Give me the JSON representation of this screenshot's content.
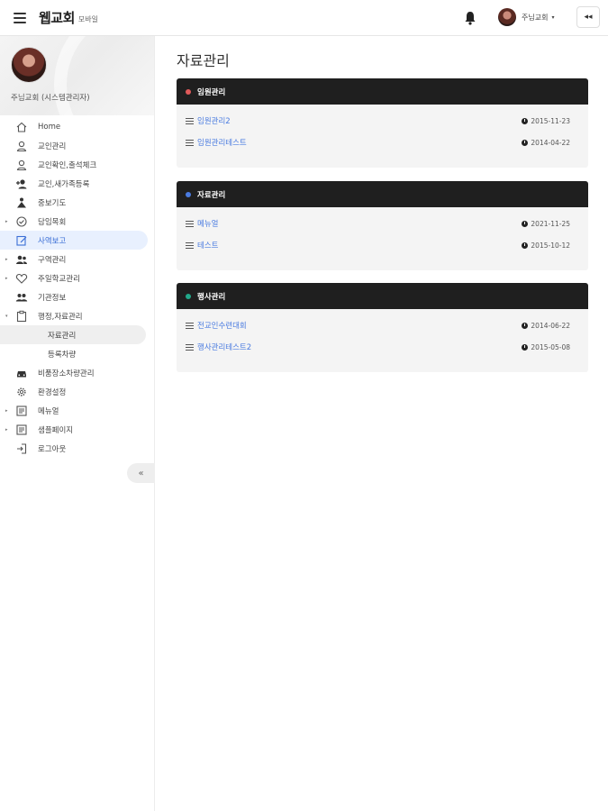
{
  "header": {
    "app_title": "웹교회",
    "app_sub": "모바일",
    "user_name": "주님교회",
    "collapse_label": "◂◂"
  },
  "sidebar": {
    "profile_name": "주님교회 (시스템관리자)",
    "items": [
      {
        "label": "Home",
        "icon": "home-icon",
        "arrow": ""
      },
      {
        "label": "교인관리",
        "icon": "person-outline-icon",
        "arrow": ""
      },
      {
        "label": "교인확인,출석체크",
        "icon": "person-check-icon",
        "arrow": ""
      },
      {
        "label": "교인,새가족등록",
        "icon": "person-add-icon",
        "arrow": ""
      },
      {
        "label": "중보기도",
        "icon": "pray-icon",
        "arrow": ""
      },
      {
        "label": "담임목회",
        "icon": "check-circle-icon",
        "arrow": "▸"
      },
      {
        "label": "사역보고",
        "icon": "edit-note-icon",
        "arrow": ""
      },
      {
        "label": "구역관리",
        "icon": "group-icon",
        "arrow": "▸"
      },
      {
        "label": "주일학교관리",
        "icon": "heart-icon",
        "arrow": "▸"
      },
      {
        "label": "기관정보",
        "icon": "people-icon",
        "arrow": ""
      },
      {
        "label": "행정,자료관리",
        "icon": "clipboard-icon",
        "arrow": "▾"
      }
    ],
    "sub_items": [
      {
        "label": "자료관리"
      },
      {
        "label": "등록차량"
      }
    ],
    "items_after": [
      {
        "label": "비품장소차량관리",
        "icon": "car-icon",
        "arrow": ""
      },
      {
        "label": "환경설정",
        "icon": "gear-icon",
        "arrow": ""
      },
      {
        "label": "메뉴얼",
        "icon": "book-icon",
        "arrow": "▸"
      },
      {
        "label": "샘플페이지",
        "icon": "page-icon",
        "arrow": "▸"
      },
      {
        "label": "로그아웃",
        "icon": "logout-icon",
        "arrow": ""
      }
    ],
    "collapse_label": "«"
  },
  "main": {
    "page_title": "자료관리",
    "panels": [
      {
        "title": "임원관리",
        "dot_color": "#e05a5a",
        "rows": [
          {
            "label": "임원관리2",
            "date": "2015-11-23"
          },
          {
            "label": "임원관리테스트",
            "date": "2014-04-22"
          }
        ]
      },
      {
        "title": "자료관리",
        "dot_color": "#4a7be0",
        "rows": [
          {
            "label": "메뉴얼",
            "date": "2021-11-25"
          },
          {
            "label": "테스트",
            "date": "2015-10-12"
          }
        ]
      },
      {
        "title": "행사관리",
        "dot_color": "#22a88a",
        "rows": [
          {
            "label": "전교인수련대회",
            "date": "2014-06-22"
          },
          {
            "label": "행사관리테스트2",
            "date": "2015-05-08"
          }
        ]
      }
    ]
  },
  "colors": {
    "accent": "#4a7be0",
    "active_bg": "#e8f0fe",
    "panel_header": "#1f1f1f"
  }
}
